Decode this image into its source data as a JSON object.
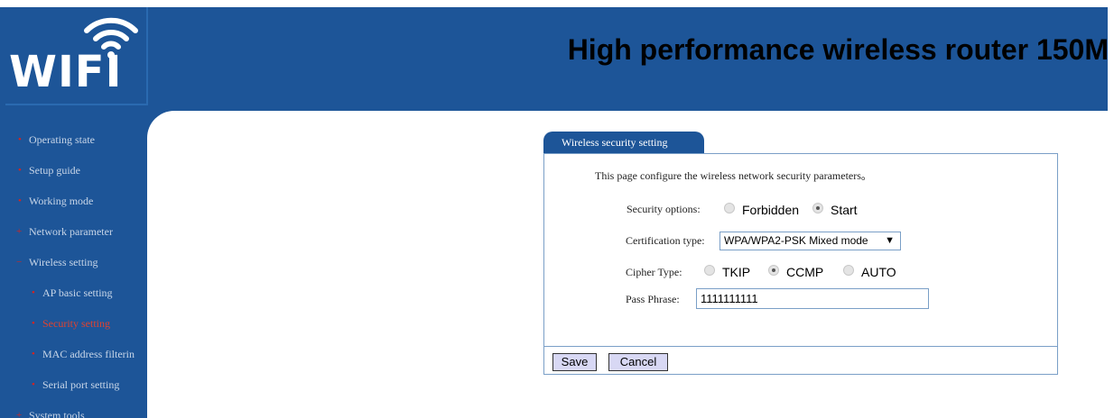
{
  "logo": {
    "text": "WIFI",
    "icon": "wifi-icon"
  },
  "header": {
    "title": "High performance wireless router  150M"
  },
  "sidebar": {
    "items": [
      {
        "label": "Operating state"
      },
      {
        "label": "Setup guide"
      },
      {
        "label": "Working mode"
      },
      {
        "label": "Network parameter"
      },
      {
        "label": "Wireless setting"
      },
      {
        "label": "AP basic setting"
      },
      {
        "label": "Security setting"
      },
      {
        "label": "MAC address filterin"
      },
      {
        "label": "Serial port setting"
      },
      {
        "label": "System tools"
      }
    ]
  },
  "main": {
    "tab_title": "Wireless security setting",
    "description": "This page configure the wireless network security parameters。",
    "security_options": {
      "label": "Security options:",
      "options": [
        "Forbidden",
        "Start"
      ],
      "selected": "Start"
    },
    "certification_type": {
      "label": "Certification type:",
      "value": "WPA/WPA2-PSK Mixed mode"
    },
    "cipher_type": {
      "label": "Cipher Type:",
      "options": [
        "TKIP",
        "CCMP",
        "AUTO"
      ],
      "selected": "CCMP"
    },
    "pass_phrase": {
      "label": "Pass Phrase:",
      "value": "1111111111"
    },
    "buttons": {
      "save": "Save",
      "cancel": "Cancel"
    }
  },
  "colors": {
    "header_bg": "#1d5598",
    "active_nav": "#e0432f",
    "bullet": "#d8231e"
  }
}
